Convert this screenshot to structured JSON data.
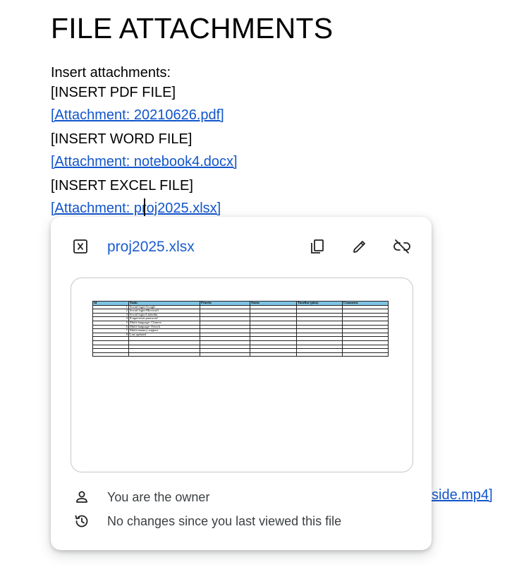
{
  "document": {
    "title": "FILE ATTACHMENTS",
    "lines": [
      {
        "text": "Insert attachments:",
        "link": false
      },
      {
        "text": "[INSERT PDF FILE]",
        "link": false
      },
      {
        "text": "[Attachment: 20210626.pdf]",
        "link": true
      },
      {
        "text": "[INSERT WORD FILE]",
        "link": false
      },
      {
        "text": "[Attachment: notebook4.docx]",
        "link": true
      },
      {
        "text": "[INSERT EXCEL FILE]",
        "link": false
      },
      {
        "text": "[Attachment: proj2025.xlsx]",
        "link": true
      }
    ],
    "partial_link_text": "side.mp4]"
  },
  "popup": {
    "file_name": "proj2025.xlsx",
    "file_icon": "excel-file-icon",
    "actions": [
      {
        "name": "copy-link-button",
        "icon": "copy-icon"
      },
      {
        "name": "edit-link-button",
        "icon": "pencil-icon"
      },
      {
        "name": "remove-link-button",
        "icon": "unlink-icon"
      }
    ],
    "preview": {
      "headers": [
        "Id",
        "Tasks",
        "Priority",
        "Status",
        "Timeline (plan)",
        "Comments"
      ],
      "rows": [
        [
          "1",
          "Social login-Google",
          "",
          "",
          "",
          ""
        ],
        [
          "2",
          "Social login-Microsoft",
          "",
          "",
          "",
          ""
        ],
        [
          "3",
          "Social login-Linkedin",
          "",
          "",
          "",
          ""
        ],
        [
          "4",
          "Forget/reset password",
          "",
          "",
          "",
          ""
        ],
        [
          "5",
          "Multi-language- Chinese",
          "",
          "",
          "",
          ""
        ],
        [
          "6",
          "Multi-language- French",
          "",
          "",
          "",
          ""
        ],
        [
          "7",
          "Multi-tenancy support",
          "",
          "",
          "",
          ""
        ],
        [
          "8",
          "Last updated",
          "",
          "",
          "",
          ""
        ],
        [
          "",
          "",
          "",
          "",
          "",
          ""
        ],
        [
          "",
          "",
          "",
          "",
          "",
          ""
        ],
        [
          "",
          "",
          "",
          "",
          "",
          ""
        ],
        [
          "",
          "",
          "",
          "",
          "",
          ""
        ],
        [
          "",
          "",
          "",
          "",
          "",
          ""
        ]
      ]
    },
    "owner_text": "You are the owner",
    "changes_text": "No changes since you last viewed this file"
  }
}
